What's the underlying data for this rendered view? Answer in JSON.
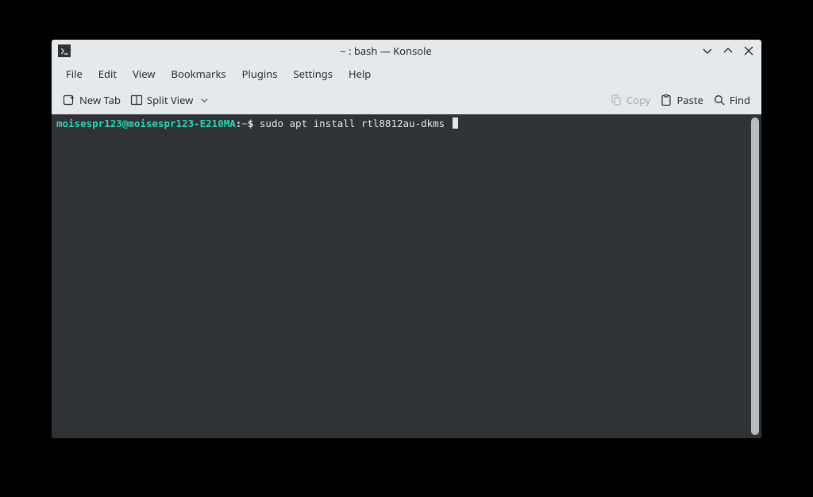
{
  "titlebar": {
    "title": "~ : bash — Konsole"
  },
  "menubar": {
    "items": [
      {
        "label": "File"
      },
      {
        "label": "Edit"
      },
      {
        "label": "View"
      },
      {
        "label": "Bookmarks"
      },
      {
        "label": "Plugins"
      },
      {
        "label": "Settings"
      },
      {
        "label": "Help"
      }
    ]
  },
  "toolbar": {
    "new_tab": "New Tab",
    "split_view": "Split View",
    "copy": "Copy",
    "paste": "Paste",
    "find": "Find"
  },
  "terminal": {
    "prompt_user_host": "moisespr123@moisespr123-E210MA",
    "prompt_colon": ":",
    "prompt_path": "~",
    "prompt_symbol": "$",
    "command": "sudo apt install rtl8812au-dkms"
  }
}
